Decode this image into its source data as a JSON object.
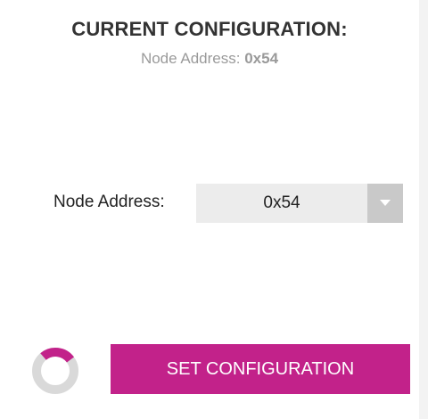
{
  "header": {
    "title": "CURRENT CONFIGURATION:",
    "subtitle_label": "Node Address:",
    "subtitle_value": "0x54"
  },
  "form": {
    "node_address_label": "Node Address:",
    "node_address_value": "0x54"
  },
  "actions": {
    "set_configuration_label": "SET CONFIGURATION"
  },
  "icons": {
    "dropdown": "chevron-down-icon",
    "spinner": "loading-spinner-icon"
  },
  "colors": {
    "accent": "#c2228a",
    "spinner_track": "#d9d9d9",
    "dropdown_bg": "#ececec",
    "dropdown_arrow_bg": "#c9c9c9"
  }
}
